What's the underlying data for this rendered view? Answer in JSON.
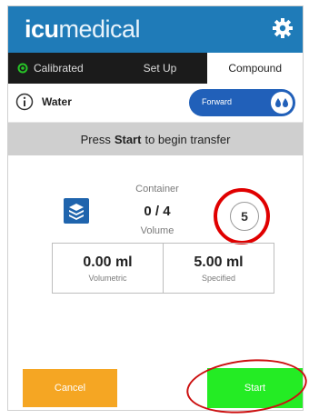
{
  "header": {
    "logo_bold": "icu",
    "logo_light": "medical",
    "settings_icon": "gear-icon",
    "color": "#1f7bb8"
  },
  "tabs": [
    {
      "label": "Calibrated",
      "icon": "calibrated-icon",
      "active": false
    },
    {
      "label": "Set Up",
      "active": false
    },
    {
      "label": "Compound",
      "active": true
    }
  ],
  "fluid": {
    "info_icon": "info-icon",
    "name": "Water",
    "direction_toggle": {
      "label": "Forward",
      "icon": "drops-icon",
      "color": "#2160b9"
    }
  },
  "banner": {
    "pre": "Press",
    "bold": "Start",
    "post": "to begin transfer"
  },
  "transfer": {
    "stack_icon": "layers-icon",
    "container_label": "Container",
    "count": "0 / 4",
    "volume_label": "Volume",
    "badge": "5"
  },
  "volumes": {
    "volumetric_value": "0.00 ml",
    "volumetric_label": "Volumetric",
    "specified_value": "5.00 ml",
    "specified_label": "Specified"
  },
  "buttons": {
    "cancel": "Cancel",
    "start": "Start",
    "cancel_color": "#f5a623",
    "start_color": "#24ec24"
  },
  "annotations": {
    "highlight_color": "#e00000"
  }
}
